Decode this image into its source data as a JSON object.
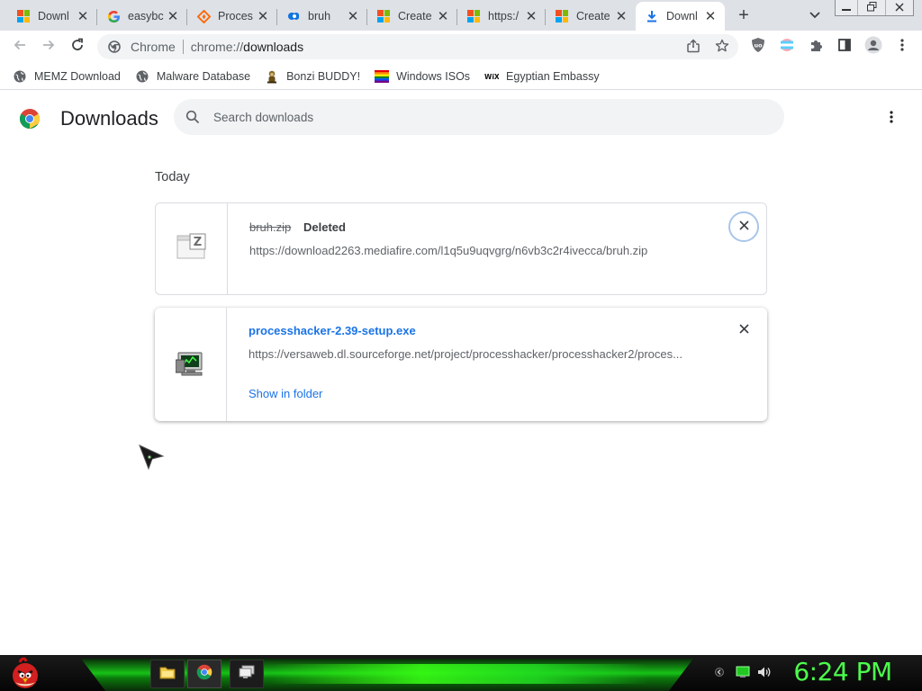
{
  "browser": {
    "tabs": [
      {
        "title": "Downl",
        "icon": "windows-flag-icon"
      },
      {
        "title": "easybc",
        "icon": "google-icon"
      },
      {
        "title": "Proces",
        "icon": "sourceforge-icon"
      },
      {
        "title": "bruh",
        "icon": "mediafire-icon"
      },
      {
        "title": "Create",
        "icon": "windows-flag-icon"
      },
      {
        "title": "https:/",
        "icon": "windows-flag-icon"
      },
      {
        "title": "Create",
        "icon": "windows-flag-icon"
      },
      {
        "title": "Downl",
        "icon": "download-icon"
      }
    ],
    "active_tab_index": 7,
    "new_tab_label": "+",
    "address_bar": {
      "site_chip": "Chrome",
      "url_scheme": "chrome://",
      "url_path": "downloads"
    },
    "bookmarks": [
      {
        "label": "MEMZ Download",
        "icon": "globe-icon"
      },
      {
        "label": "Malware Database",
        "icon": "globe-icon"
      },
      {
        "label": "Bonzi BUDDY!",
        "icon": "bonzi-icon"
      },
      {
        "label": "Windows ISOs",
        "icon": "rainbow-icon"
      },
      {
        "label": "Egyptian Embassy",
        "icon": "wix-icon"
      }
    ]
  },
  "downloads_page": {
    "title": "Downloads",
    "search_placeholder": "Search downloads",
    "date_group": "Today",
    "items": [
      {
        "file_name": "bruh.zip",
        "status": "Deleted",
        "url": "https://download2263.mediafire.com/l1q5u9uqvgrg/n6vb3c2r4ivecca/bruh.zip",
        "icon": "zip-file-icon"
      },
      {
        "file_name": "processhacker-2.39-setup.exe",
        "url": "https://versaweb.dl.sourceforge.net/project/processhacker/processhacker2/proces...",
        "action_label": "Show in folder",
        "icon": "exe-installer-icon"
      }
    ]
  },
  "taskbar": {
    "clock": "6:24 PM",
    "accent_color": "#39ff14"
  },
  "colors": {
    "link_blue": "#1a73e8",
    "tab_strip": "#dee1e6",
    "omnibox": "#f1f3f4"
  }
}
